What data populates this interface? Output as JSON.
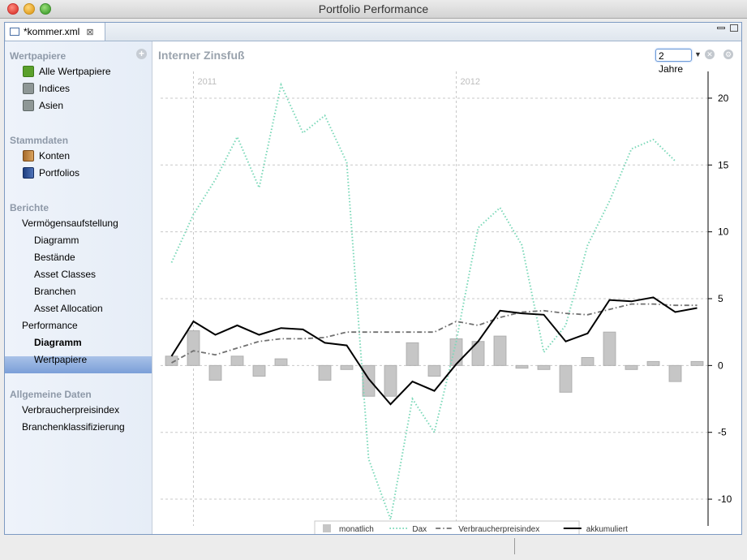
{
  "window": {
    "title": "Portfolio Performance"
  },
  "tab": {
    "label": "*kommer.xml",
    "close": "⊠"
  },
  "sidebar": {
    "sections": [
      {
        "title": "Wertpapiere",
        "items": [
          {
            "label": "Alle Wertpapiere",
            "icon": "chart-green-icon"
          },
          {
            "label": "Indices",
            "icon": "chart-gray-icon"
          },
          {
            "label": "Asien",
            "icon": "chart-gray-icon"
          }
        ]
      },
      {
        "title": "Stammdaten",
        "items": [
          {
            "label": "Konten",
            "icon": "account-book-icon"
          },
          {
            "label": "Portfolios",
            "icon": "portfolio-book-icon"
          }
        ]
      },
      {
        "title": "Berichte",
        "items": [
          {
            "label": "Vermögensaufstellung"
          },
          {
            "label": "Diagramm"
          },
          {
            "label": "Bestände"
          },
          {
            "label": "Asset Classes"
          },
          {
            "label": "Branchen"
          },
          {
            "label": "Asset Allocation"
          },
          {
            "label": "Performance"
          },
          {
            "label": "Diagramm",
            "selected": true
          },
          {
            "label": "Wertpapiere"
          }
        ]
      },
      {
        "title": "Allgemeine Daten",
        "items": [
          {
            "label": "Verbraucherpreisindex"
          },
          {
            "label": "Branchenklassifizierung"
          }
        ]
      }
    ]
  },
  "content": {
    "title": "Interner Zinsfuß",
    "period_value": "2 Jahre"
  },
  "colors": {
    "accent": "#7b9fd8",
    "dax": "#7ad8b8",
    "bars": "#c6c6c6",
    "cpi": "#707070",
    "cum": "#000000"
  },
  "chart_data": {
    "type": "line",
    "x_labels": [
      "2011",
      "2012"
    ],
    "ylim": [
      -12,
      22
    ],
    "yticks": [
      -10,
      -5,
      0,
      5,
      10,
      15,
      20
    ],
    "grid": true,
    "legend": "bottom",
    "n_points": 25,
    "series": [
      {
        "name": "monatlich",
        "kind": "bar",
        "values": [
          0.7,
          2.6,
          -1.1,
          0.7,
          -0.8,
          0.5,
          0,
          -1.1,
          -0.3,
          -2.3,
          -2.3,
          1.7,
          -0.8,
          2.0,
          1.8,
          2.2,
          -0.2,
          -0.3,
          -2.0,
          0.6,
          2.5,
          -0.3,
          0.3,
          -1.2,
          0.3
        ]
      },
      {
        "name": "Dax",
        "kind": "dotted",
        "values": [
          7.7,
          11.3,
          13.9,
          17.1,
          13.3,
          21.0,
          17.4,
          18.7,
          15.2,
          -7.0,
          -11.5,
          -2.5,
          -5.0,
          1.8,
          10.3,
          11.8,
          9.0,
          1.0,
          3.0,
          9.0,
          12.3,
          16.2,
          16.9,
          15.3,
          null
        ]
      },
      {
        "name": "Verbraucherpreisindex",
        "kind": "dashdot",
        "values": [
          0.2,
          1.1,
          0.8,
          1.3,
          1.8,
          2.0,
          2.0,
          2.1,
          2.5,
          2.5,
          2.5,
          2.5,
          2.5,
          3.3,
          3.0,
          3.6,
          4.0,
          4.1,
          3.9,
          3.8,
          4.2,
          4.6,
          4.6,
          4.5,
          4.5
        ]
      },
      {
        "name": "akkumuliert",
        "kind": "solid",
        "values": [
          0.7,
          3.3,
          2.3,
          3.0,
          2.3,
          2.8,
          2.7,
          1.7,
          1.5,
          -1.0,
          -2.9,
          -1.2,
          -1.9,
          0.1,
          1.8,
          4.1,
          3.9,
          3.8,
          1.8,
          2.4,
          4.9,
          4.8,
          5.1,
          4.0,
          4.3
        ]
      }
    ]
  }
}
